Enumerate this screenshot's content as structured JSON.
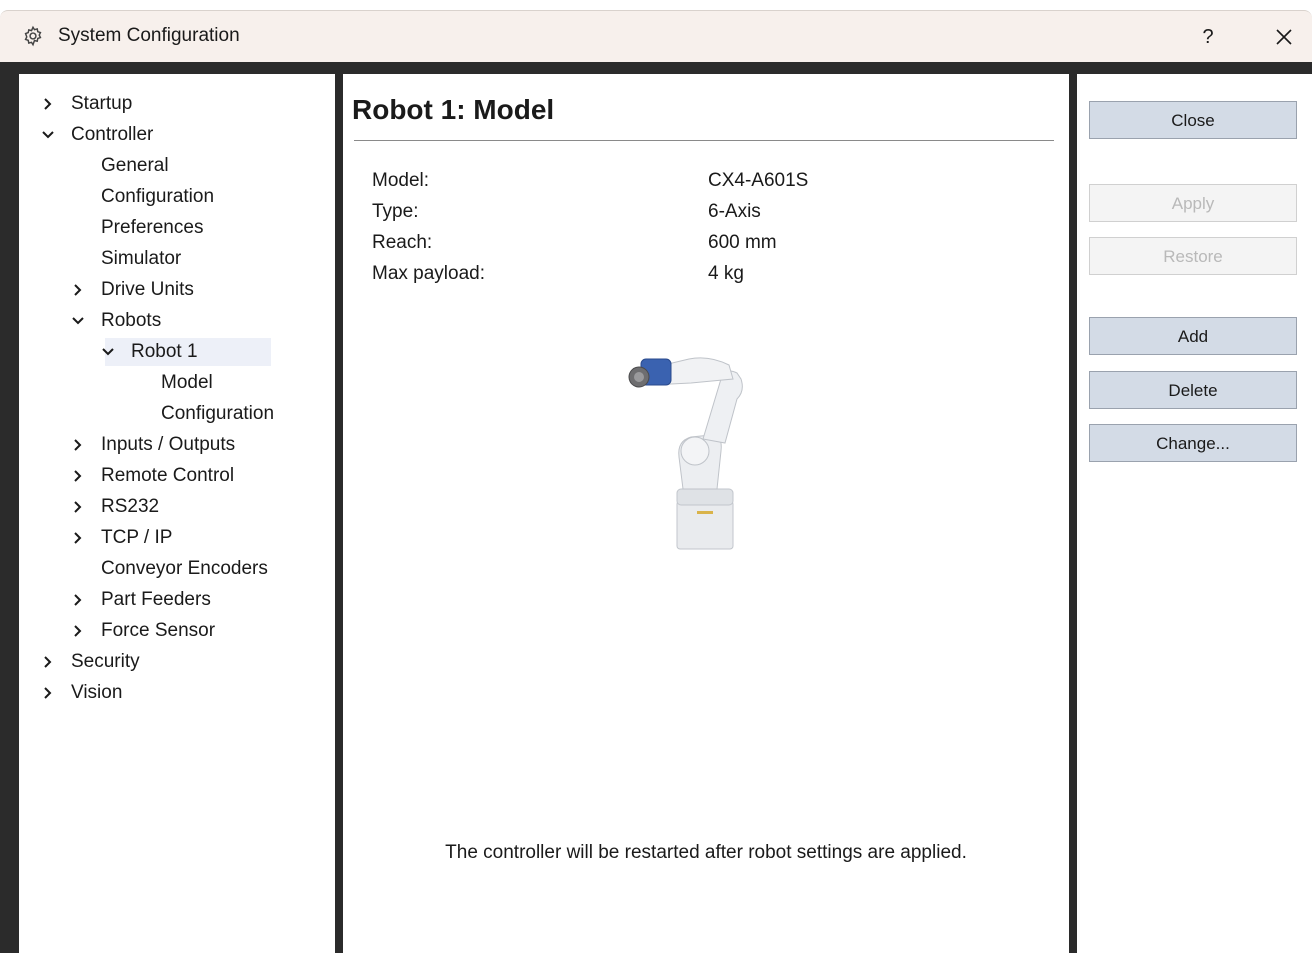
{
  "window": {
    "title": "System Configuration",
    "help_label": "?",
    "icon": "gear-icon"
  },
  "tree": {
    "items": [
      {
        "label": "Startup",
        "indent": 0,
        "chevron": "right"
      },
      {
        "label": "Controller",
        "indent": 0,
        "chevron": "down"
      },
      {
        "label": "General",
        "indent": 1,
        "chevron": "none"
      },
      {
        "label": "Configuration",
        "indent": 1,
        "chevron": "none"
      },
      {
        "label": "Preferences",
        "indent": 1,
        "chevron": "none"
      },
      {
        "label": "Simulator",
        "indent": 1,
        "chevron": "none"
      },
      {
        "label": "Drive Units",
        "indent": 1,
        "chevron": "right"
      },
      {
        "label": "Robots",
        "indent": 1,
        "chevron": "down"
      },
      {
        "label": "Robot 1",
        "indent": 2,
        "chevron": "down",
        "selected": true
      },
      {
        "label": "Model",
        "indent": 3,
        "chevron": "none"
      },
      {
        "label": "Configuration",
        "indent": 3,
        "chevron": "none"
      },
      {
        "label": "Inputs / Outputs",
        "indent": 1,
        "chevron": "right"
      },
      {
        "label": "Remote Control",
        "indent": 1,
        "chevron": "right"
      },
      {
        "label": "RS232",
        "indent": 1,
        "chevron": "right"
      },
      {
        "label": "TCP / IP",
        "indent": 1,
        "chevron": "right"
      },
      {
        "label": "Conveyor Encoders",
        "indent": 1,
        "chevron": "none"
      },
      {
        "label": "Part Feeders",
        "indent": 1,
        "chevron": "right"
      },
      {
        "label": "Force Sensor",
        "indent": 1,
        "chevron": "right"
      },
      {
        "label": "Security",
        "indent": 0,
        "chevron": "right"
      },
      {
        "label": "Vision",
        "indent": 0,
        "chevron": "right"
      }
    ]
  },
  "main": {
    "title": "Robot 1: Model",
    "properties": [
      {
        "label": "Model:",
        "value": "CX4-A601S"
      },
      {
        "label": "Type:",
        "value": "6-Axis"
      },
      {
        "label": "Reach:",
        "value": "600 mm"
      },
      {
        "label": "Max payload:",
        "value": "4 kg"
      }
    ],
    "note": "The controller will be restarted after robot settings are applied."
  },
  "buttons": {
    "close": "Close",
    "apply": "Apply",
    "restore": "Restore",
    "add": "Add",
    "delete": "Delete",
    "change": "Change..."
  }
}
